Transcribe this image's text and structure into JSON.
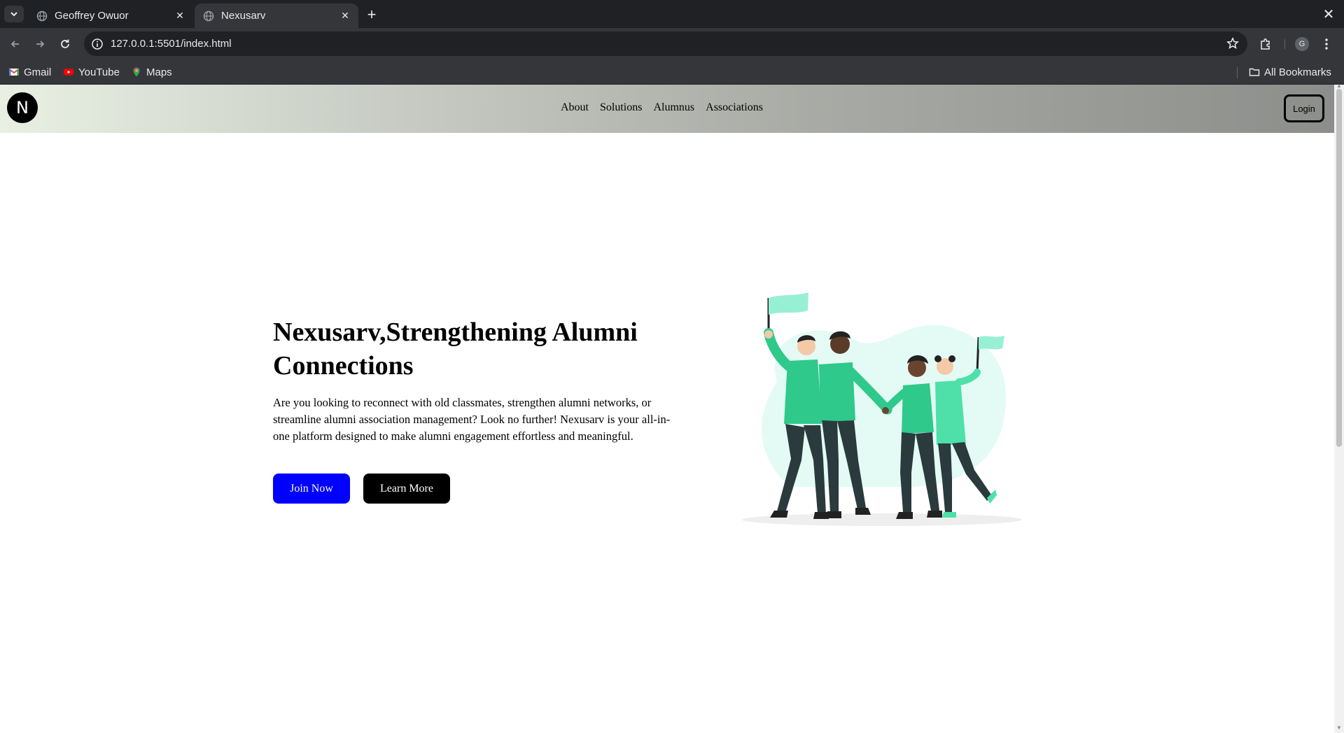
{
  "browser": {
    "tabs": [
      {
        "title": "Geoffrey Owuor",
        "active": false
      },
      {
        "title": "Nexusarv",
        "active": true
      }
    ],
    "url": "127.0.0.1:5501/index.html",
    "profile_initial": "G",
    "bookmarks": [
      {
        "label": "Gmail",
        "icon": "gmail-icon"
      },
      {
        "label": "YouTube",
        "icon": "youtube-icon"
      },
      {
        "label": "Maps",
        "icon": "maps-icon"
      }
    ],
    "all_bookmarks_label": "All Bookmarks"
  },
  "site": {
    "logo_letter": "N",
    "nav": [
      "About",
      "Solutions",
      "Alumnus",
      "Associations"
    ],
    "login_label": "Login"
  },
  "hero": {
    "title": "Nexusarv,Strengthening Alumni Connections",
    "text": "Are you looking to reconnect with old classmates, strengthen alumni networks, or streamline alumni association management? Look no further! Nexusarv is your all-in-one platform designed to make alumni engagement effortless and meaningful.",
    "join_label": "Join Now",
    "learn_label": "Learn More",
    "illustration": "people-celebrating-with-flags"
  },
  "colors": {
    "accent_blue": "#0000ff",
    "illustration_green": "#2ec98b",
    "illustration_mint": "#d9faf0"
  }
}
